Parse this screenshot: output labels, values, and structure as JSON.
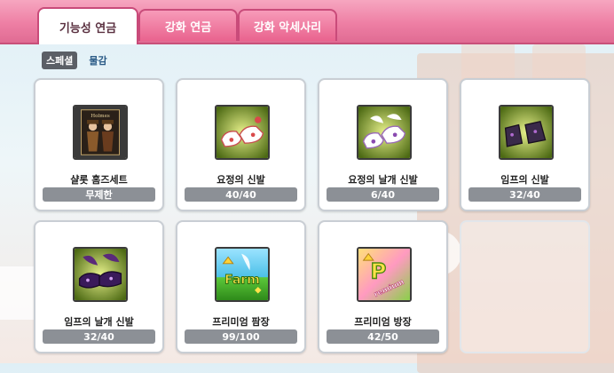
{
  "tabs": [
    {
      "label": "기능성 연금",
      "active": true
    },
    {
      "label": "강화 연금",
      "active": false
    },
    {
      "label": "강화 악세사리",
      "active": false
    }
  ],
  "subtabs": [
    {
      "label": "스페셜",
      "active": true
    },
    {
      "label": "물감",
      "active": false
    }
  ],
  "items": [
    {
      "name": "샬롯 홈즈세트",
      "status": "무제한",
      "icon": "holmes-costume-set-icon"
    },
    {
      "name": "요정의 신발",
      "status": "40/40",
      "icon": "fairy-shoes-icon"
    },
    {
      "name": "요정의 날개 신발",
      "status": "6/40",
      "icon": "fairy-wing-shoes-icon"
    },
    {
      "name": "임프의 신발",
      "status": "32/40",
      "icon": "imp-shoes-icon"
    },
    {
      "name": "임프의 날개 신발",
      "status": "32/40",
      "icon": "imp-wing-shoes-icon"
    },
    {
      "name": "프리미엄 팜장",
      "status": "99/100",
      "icon": "premium-farm-icon"
    },
    {
      "name": "프리미엄 방장",
      "status": "42/50",
      "icon": "premium-room-icon"
    }
  ],
  "colors": {
    "tab_active_bg": "#ffffff",
    "tab_inactive_bg": "#ee7fa4",
    "topbar": "#ee7fa4",
    "status_bar": "#8c9096"
  }
}
